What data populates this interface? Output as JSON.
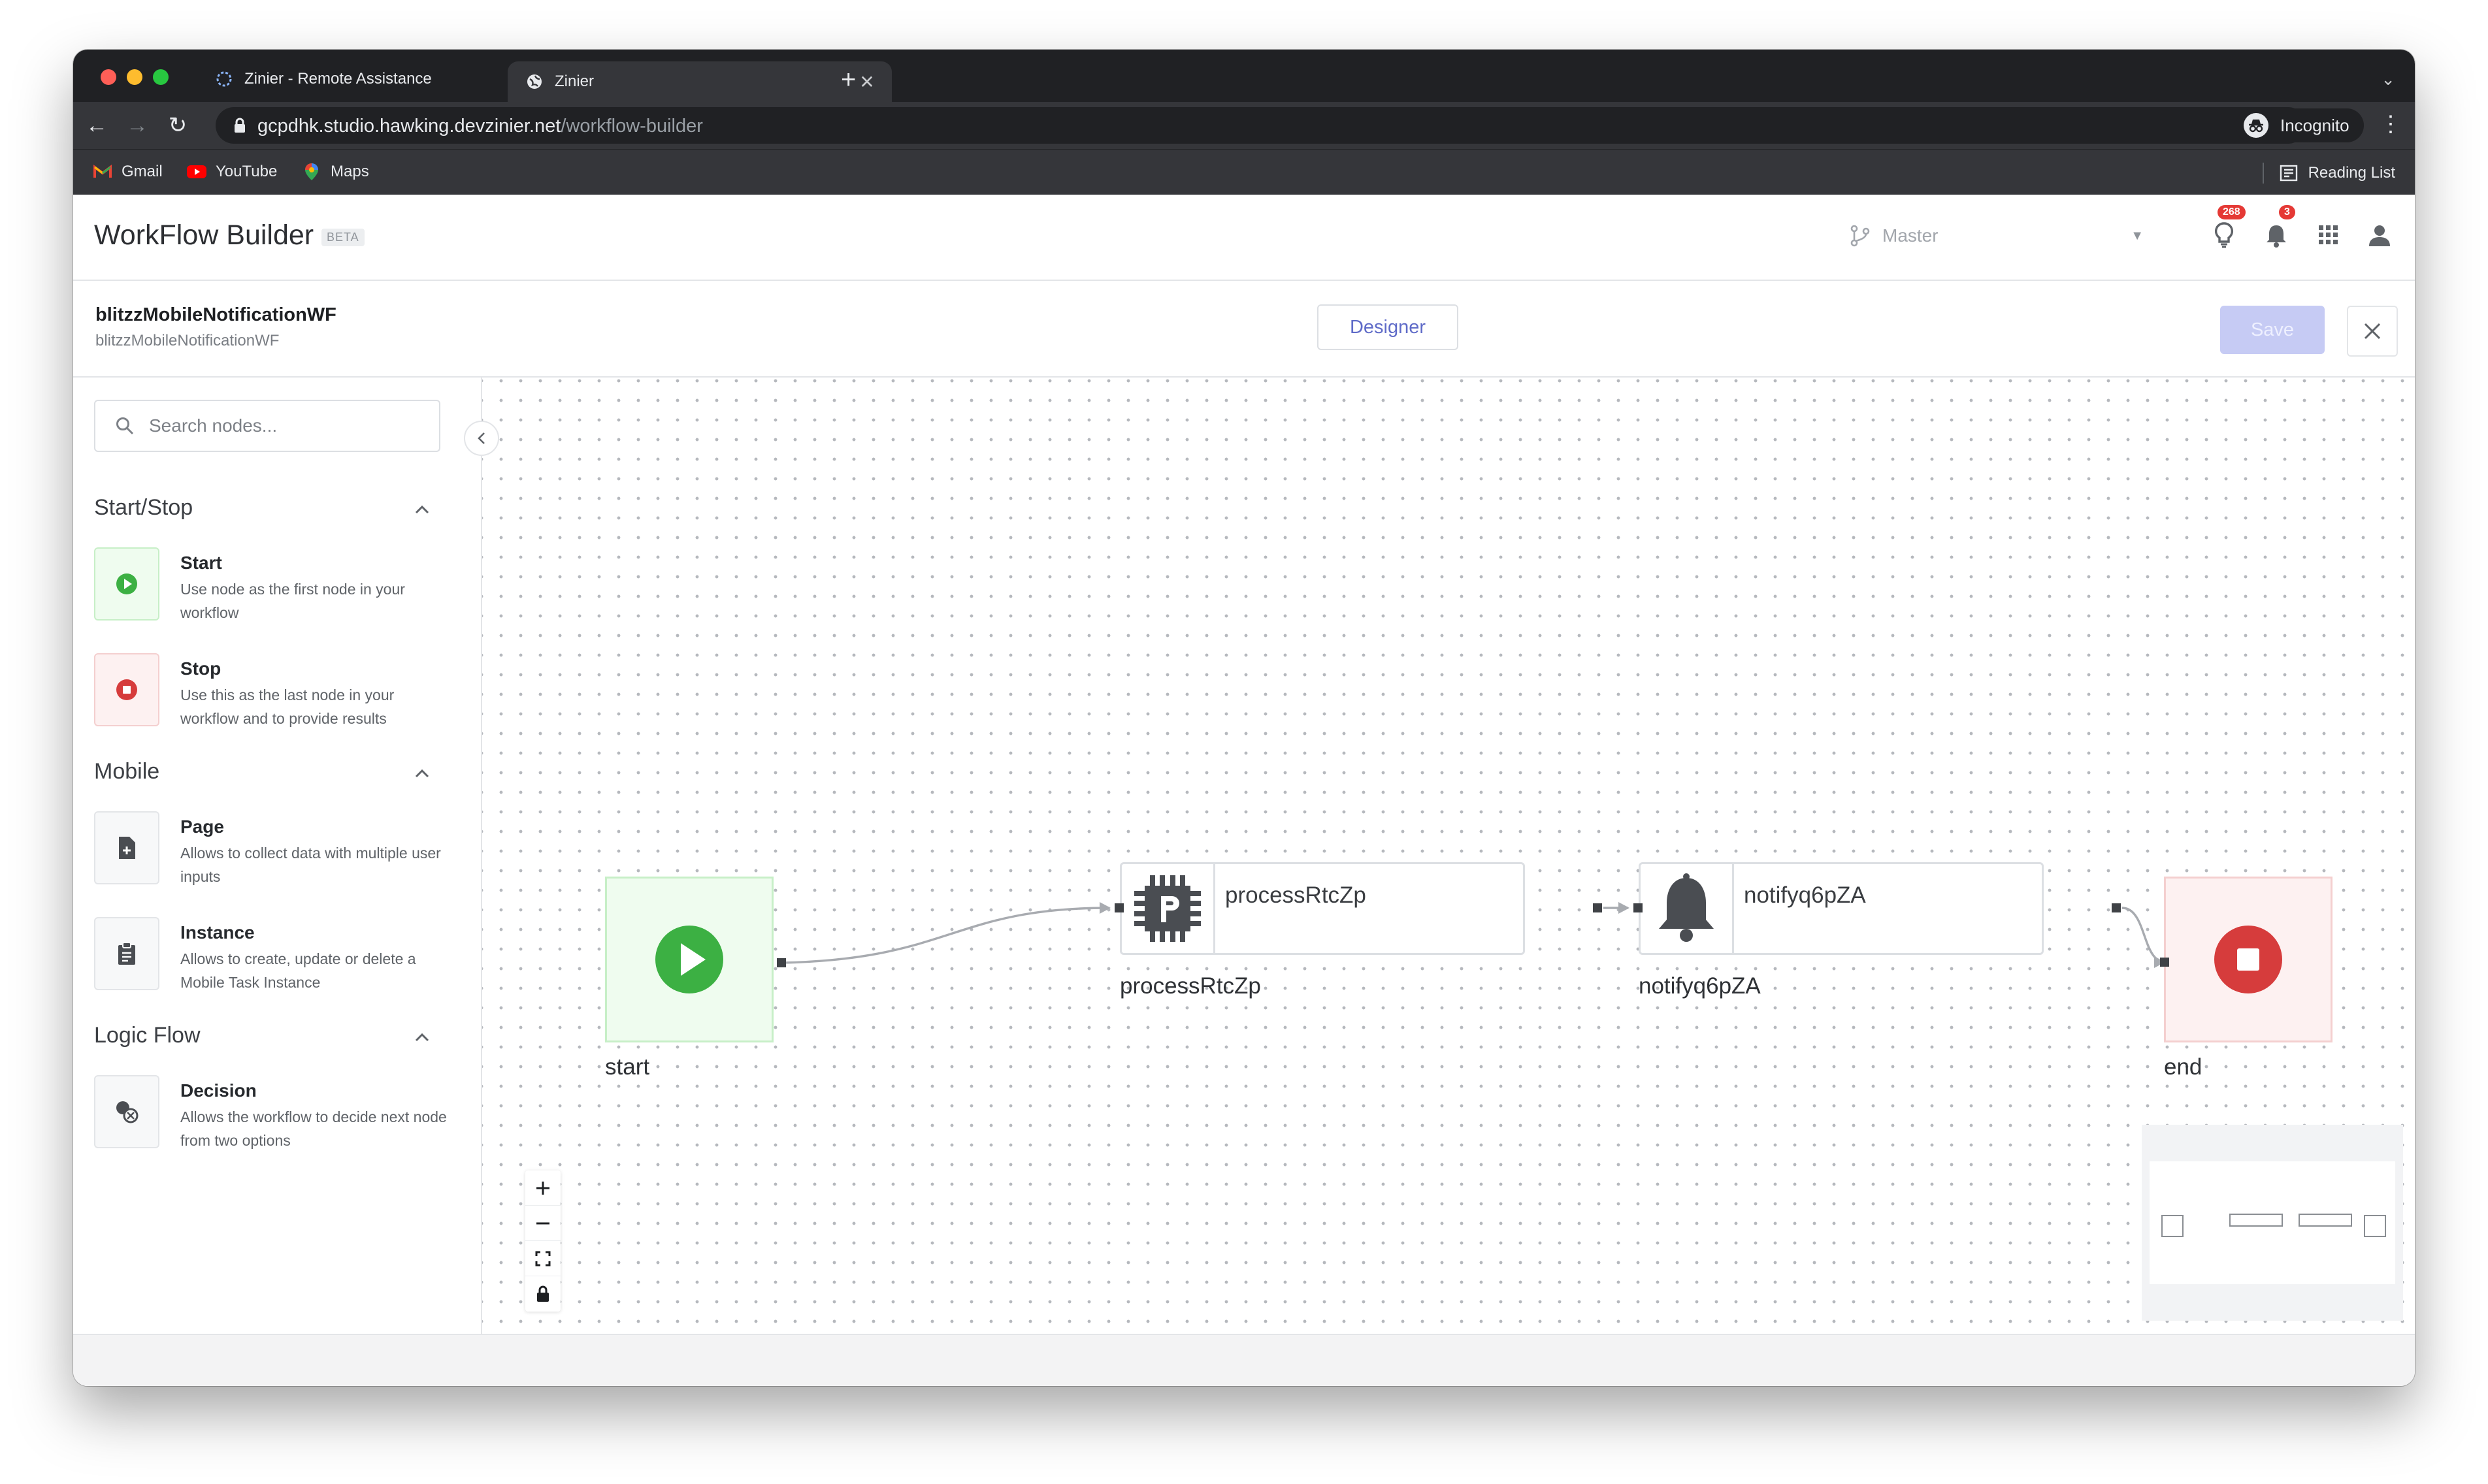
{
  "browser": {
    "tabs": [
      {
        "title": "Zinier - Remote Assistance",
        "active": false
      },
      {
        "title": "Zinier",
        "active": true
      }
    ],
    "url_host": "gcpdhk.studio.hawking.devzinier.net",
    "url_path": "/workflow-builder",
    "profile_label": "Incognito",
    "bookmarks": [
      "Gmail",
      "YouTube",
      "Maps"
    ],
    "reading_list": "Reading List"
  },
  "app": {
    "title": "WorkFlow Builder",
    "beta": "BETA",
    "branch": "Master",
    "badges": {
      "ideas": "268",
      "notifications": "3"
    }
  },
  "workflow": {
    "name": "blitzzMobileNotificationWF",
    "sub_name": "blitzzMobileNotificationWF",
    "designer_label": "Designer",
    "save_label": "Save"
  },
  "sidebar": {
    "search_placeholder": "Search nodes...",
    "sections": [
      {
        "title": "Start/Stop",
        "items": [
          {
            "name": "Start",
            "desc": "Use node as the first node in your workflow"
          },
          {
            "name": "Stop",
            "desc": "Use this as the last node in your workflow and to provide results"
          }
        ]
      },
      {
        "title": "Mobile",
        "items": [
          {
            "name": "Page",
            "desc": "Allows to collect data with multiple user inputs"
          },
          {
            "name": "Instance",
            "desc": "Allows to create, update or delete a Mobile Task Instance"
          }
        ]
      },
      {
        "title": "Logic Flow",
        "items": [
          {
            "name": "Decision",
            "desc": "Allows the workflow to decide next node from two options"
          }
        ]
      }
    ]
  },
  "canvas": {
    "nodes": [
      {
        "id": "start",
        "caption": "start"
      },
      {
        "id": "process",
        "label": "processRtcZp",
        "caption": "processRtcZp"
      },
      {
        "id": "notify",
        "label": "notifyq6pZA",
        "caption": "notifyq6pZA"
      },
      {
        "id": "end",
        "caption": "end"
      }
    ]
  },
  "colors": {
    "accent": "#5f6bc8",
    "start_green": "#3cb043",
    "stop_red": "#d63c3c"
  }
}
